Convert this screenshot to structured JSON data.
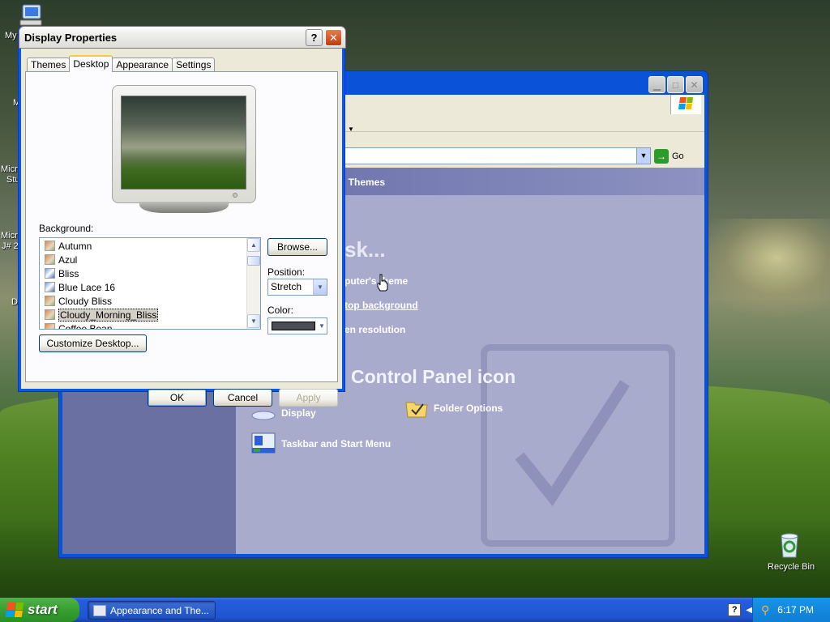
{
  "desktop": {
    "icons": [
      {
        "label": "My",
        "name": "my-computer-icon"
      },
      {
        "label": "M",
        "name": "my-network-icon"
      },
      {
        "label": "Micro",
        "name": "ms-icon-1"
      },
      {
        "label": "Stu",
        "name": "ms-icon-1-line2"
      },
      {
        "label": "Micro",
        "name": "ms-icon-2"
      },
      {
        "label": "J# 2",
        "name": "ms-icon-2-line2"
      },
      {
        "label": "D",
        "name": "d-icon"
      }
    ],
    "recycle_bin": "Recycle Bin"
  },
  "control_panel": {
    "address_go": "Go",
    "header": "d Themes",
    "pick_task": "sk...",
    "tasks": [
      "puter's theme",
      "top background",
      "en resolution"
    ],
    "pick_icon": "Control Panel icon",
    "items": [
      {
        "label": "Display",
        "name": "display-item"
      },
      {
        "label": "Folder Options",
        "name": "folder-options-item"
      },
      {
        "label": "Taskbar and Start Menu",
        "name": "taskbar-start-menu-item"
      }
    ]
  },
  "dialog": {
    "title": "Display Properties",
    "help_glyph": "?",
    "close_glyph": "✕",
    "tabs": [
      "Themes",
      "Desktop",
      "Appearance",
      "Settings"
    ],
    "active_tab": "Desktop",
    "background_label": "Background:",
    "backgrounds": [
      "Autumn",
      "Azul",
      "Bliss",
      "Blue Lace 16",
      "Cloudy Bliss",
      "Cloudy_Morning_Bliss",
      "Coffee Bean"
    ],
    "selected_background": "Cloudy_Morning_Bliss",
    "browse_label": "Browse...",
    "position_label": "Position:",
    "position_value": "Stretch",
    "color_label": "Color:",
    "color_value": "#4a4c55",
    "customize_label": "Customize Desktop...",
    "ok_label": "OK",
    "cancel_label": "Cancel",
    "apply_label": "Apply"
  },
  "taskbar": {
    "start_label": "start",
    "task_button": "Appearance and The...",
    "clock": "6:17 PM"
  }
}
